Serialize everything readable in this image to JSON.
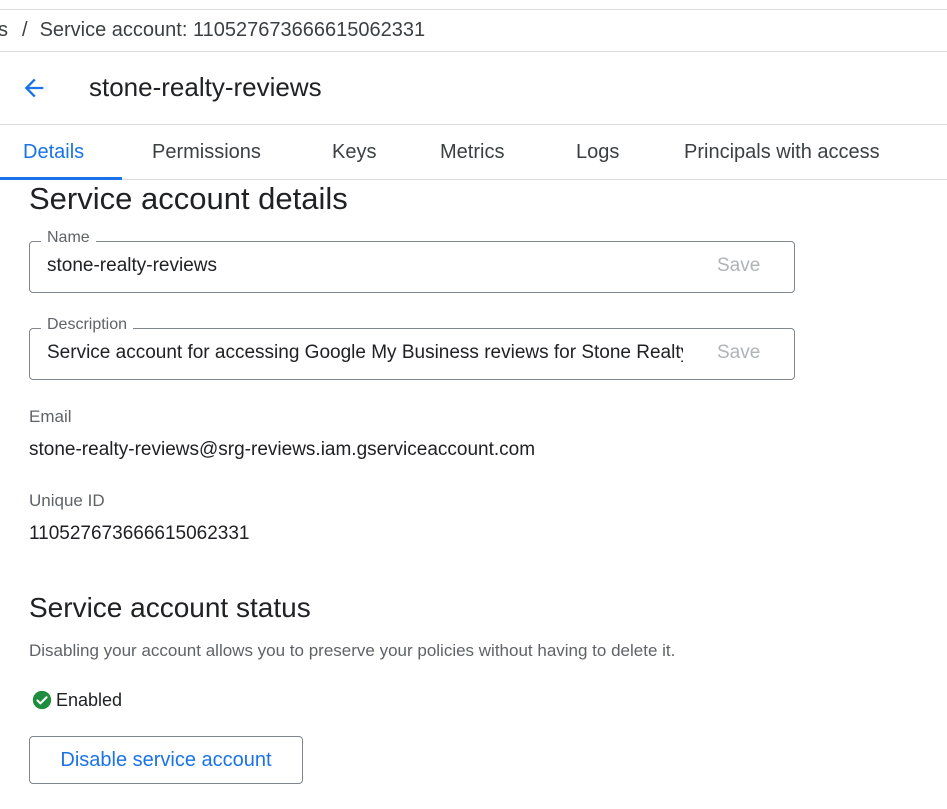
{
  "breadcrumb": {
    "previous": "s",
    "separator": "/",
    "current": "Service account: 110527673666615062331"
  },
  "header": {
    "back_icon": "arrow-back-icon",
    "title": "stone-realty-reviews"
  },
  "tabs": [
    {
      "label": "Details",
      "active": true
    },
    {
      "label": "Permissions",
      "active": false
    },
    {
      "label": "Keys",
      "active": false
    },
    {
      "label": "Metrics",
      "active": false
    },
    {
      "label": "Logs",
      "active": false
    },
    {
      "label": "Principals with access",
      "active": false
    }
  ],
  "details": {
    "title": "Service account details",
    "name": {
      "label": "Name",
      "value": "stone-realty-reviews",
      "save_label": "Save"
    },
    "description": {
      "label": "Description",
      "value": "Service account for accessing Google My Business reviews for Stone Realty",
      "save_label": "Save"
    },
    "email": {
      "label": "Email",
      "value": "stone-realty-reviews@srg-reviews.iam.gserviceaccount.com"
    },
    "unique_id": {
      "label": "Unique ID",
      "value": "110527673666615062331"
    }
  },
  "status": {
    "title": "Service account status",
    "description": "Disabling your account allows you to preserve your policies without having to delete it.",
    "state_icon": "check-circle-icon",
    "state": "Enabled",
    "disable_button": "Disable service account"
  },
  "colors": {
    "accent": "#1a73e8",
    "success": "#1e8e3e",
    "border": "#dadce0",
    "muted_text": "#5f6368"
  }
}
